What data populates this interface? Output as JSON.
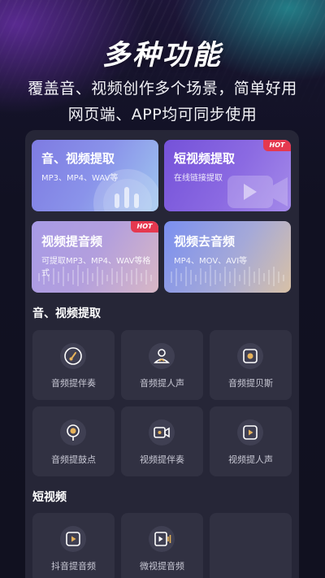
{
  "header": {
    "headline": "多种功能",
    "line1": "覆盖音、视频创作多个场景，简单好用",
    "line2": "网页端、APP均可同步使用"
  },
  "cards": [
    {
      "title": "音、视频提取",
      "subtitle": "MP3、MP4、WAV等",
      "hot": ""
    },
    {
      "title": "短视频提取",
      "subtitle": "在线链接提取",
      "hot": "HOT"
    },
    {
      "title": "视频提音频",
      "subtitle": "可提取MP3、MP4、WAV等格式",
      "hot": "HOT"
    },
    {
      "title": "视频去音频",
      "subtitle": "MP4、MOV、AVI等",
      "hot": ""
    }
  ],
  "sections": [
    {
      "title": "音、视频提取",
      "tools": [
        {
          "label": "音频提伴奏",
          "icon": "guitar-icon"
        },
        {
          "label": "音频提人声",
          "icon": "person-voice-icon"
        },
        {
          "label": "音频提贝斯",
          "icon": "speaker-icon"
        },
        {
          "label": "音频提鼓点",
          "icon": "drum-pin-icon"
        },
        {
          "label": "视频提伴奏",
          "icon": "video-camera-icon"
        },
        {
          "label": "视频提人声",
          "icon": "video-play-icon"
        }
      ]
    },
    {
      "title": "短视频",
      "tools": [
        {
          "label": "抖音提音频",
          "icon": "video-play-icon"
        },
        {
          "label": "微视提音频",
          "icon": "video-audio-icon"
        },
        {
          "label": "",
          "icon": ""
        }
      ]
    }
  ],
  "colors": {
    "background": "#11111f",
    "panel": "#262637",
    "tile": "#313142",
    "hot_badge": "#e5384f",
    "icon_accent": "#e6b25a"
  }
}
